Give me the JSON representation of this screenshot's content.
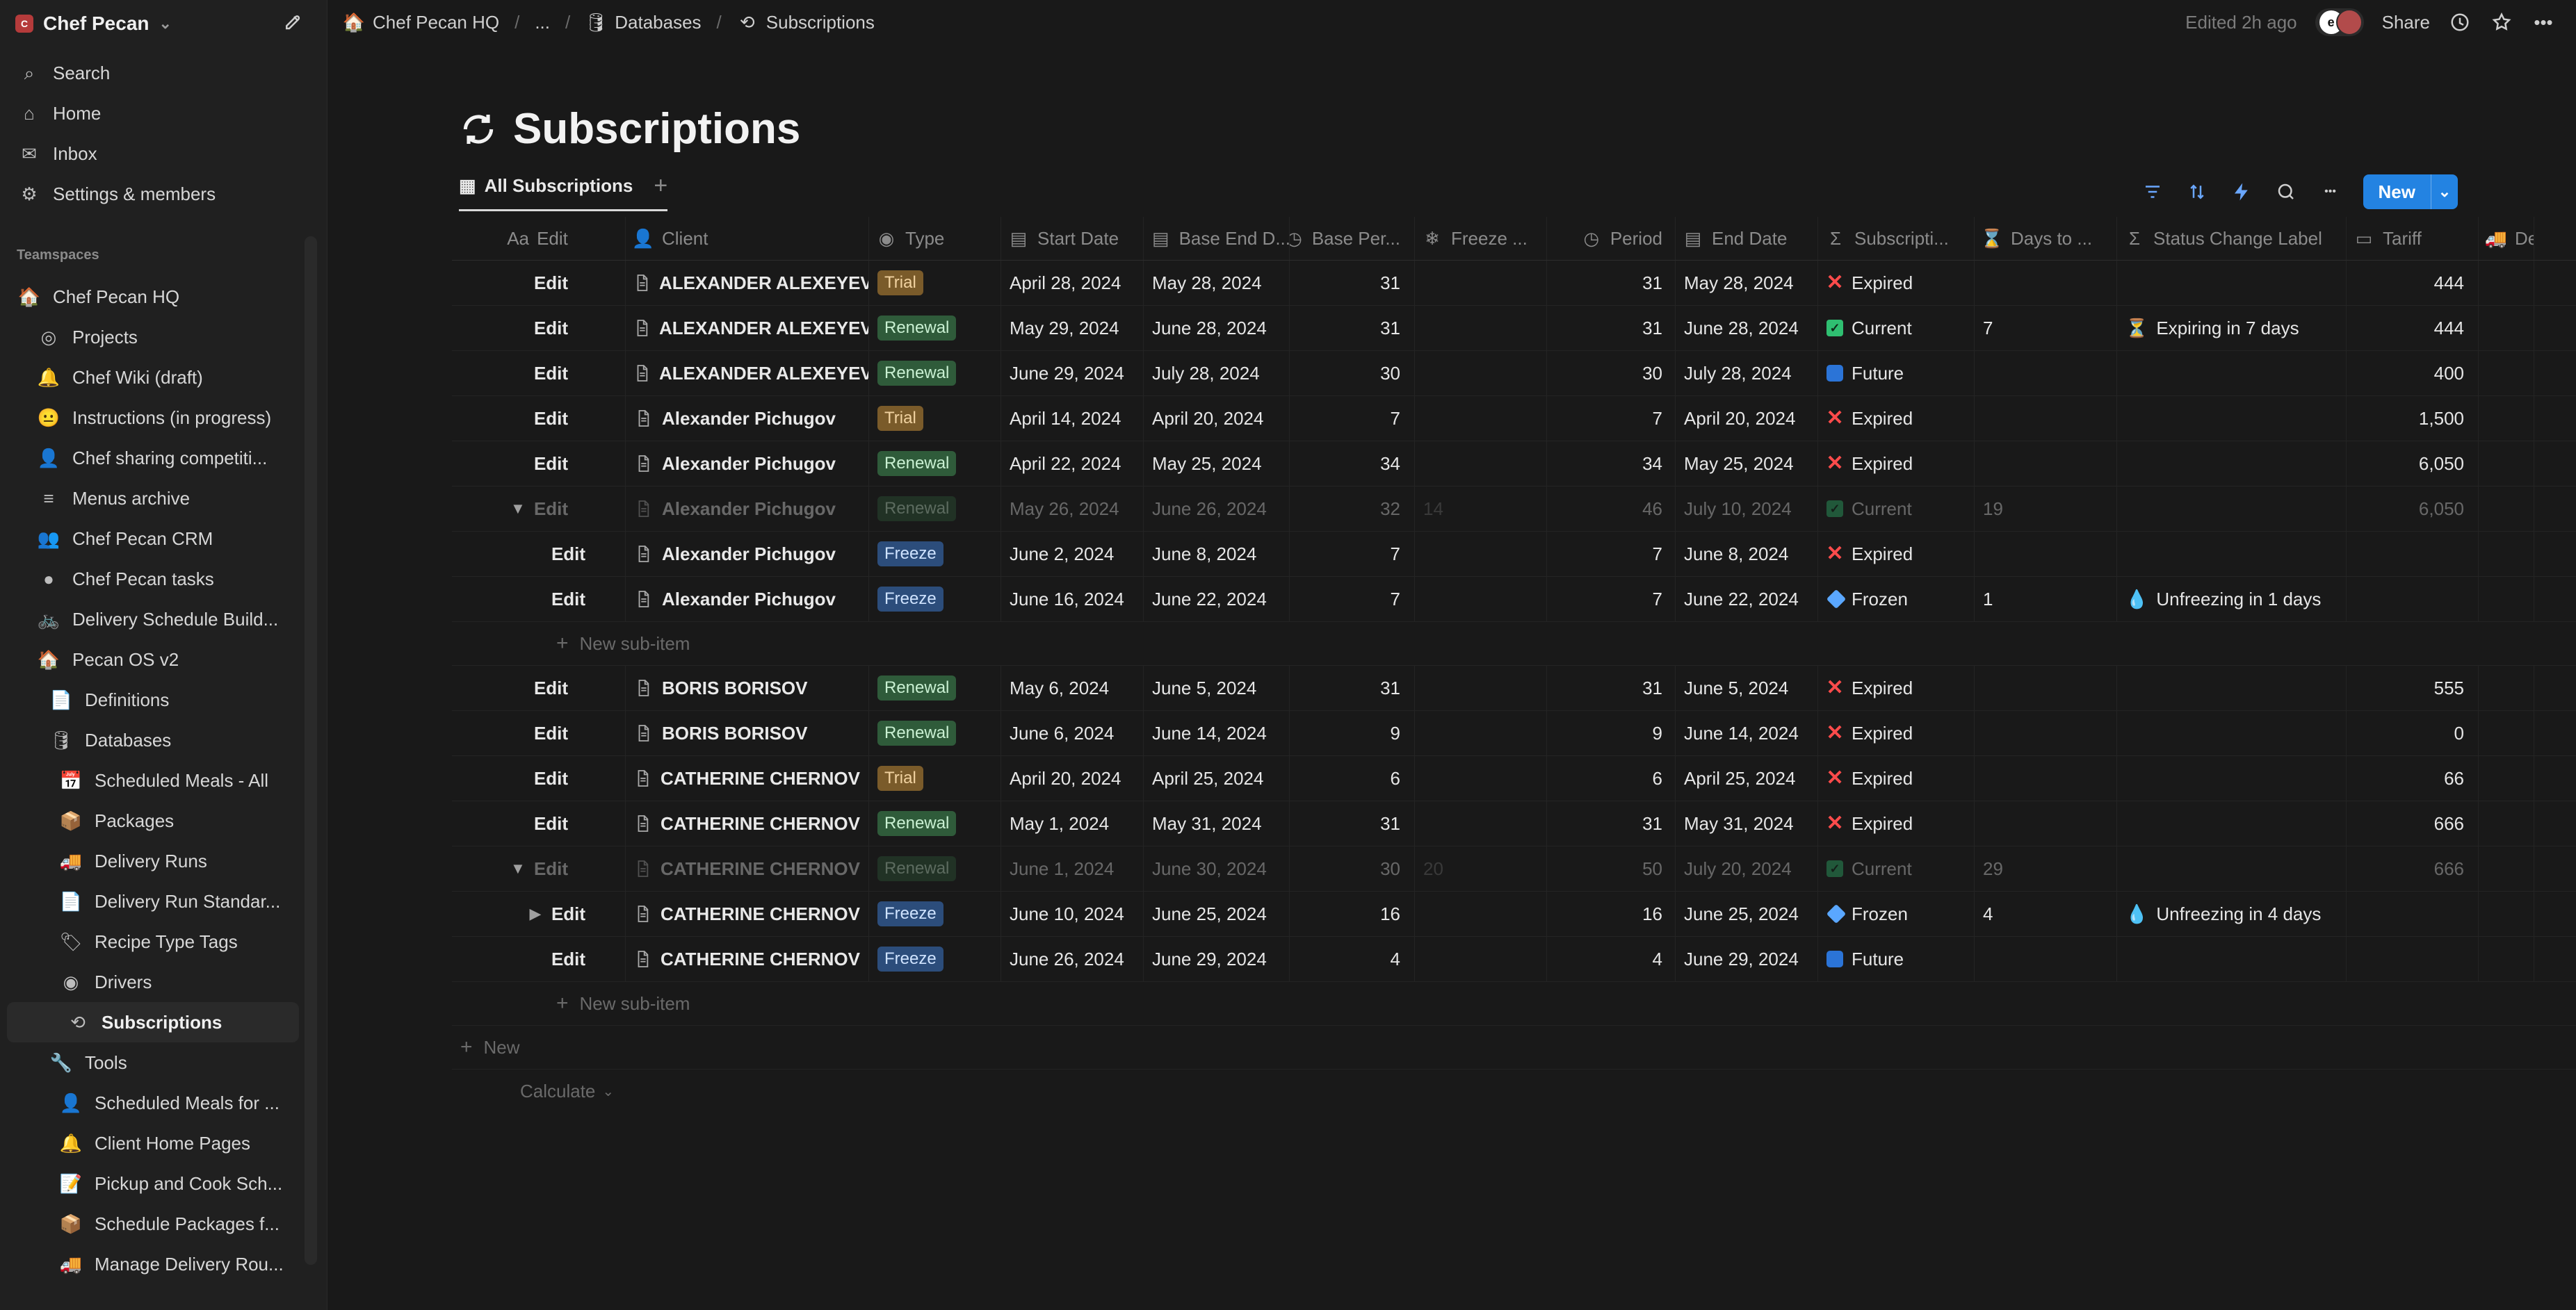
{
  "sidebar": {
    "workspace": {
      "name": "Chef Pecan",
      "avatar_letter": "C"
    },
    "nav": [
      {
        "name": "search",
        "label": "Search",
        "icon": "search-icon"
      },
      {
        "name": "home",
        "label": "Home",
        "icon": "home-icon"
      },
      {
        "name": "inbox",
        "label": "Inbox",
        "icon": "inbox-icon"
      },
      {
        "name": "settings",
        "label": "Settings & members",
        "icon": "gear-icon"
      }
    ],
    "section_label": "Teamspaces",
    "tree": [
      {
        "label": "Chef Pecan HQ",
        "icon": "house-icon",
        "level": 1
      },
      {
        "label": "Projects",
        "icon": "target-icon",
        "level": 2
      },
      {
        "label": "Chef Wiki (draft)",
        "icon": "bell-icon",
        "level": 2
      },
      {
        "label": "Instructions (in progress)",
        "icon": "face-icon",
        "level": 2
      },
      {
        "label": "Chef sharing competiti...",
        "icon": "person-icon",
        "level": 2
      },
      {
        "label": "Menus archive",
        "icon": "list-icon",
        "level": 2
      },
      {
        "label": "Chef Pecan CRM",
        "icon": "people-icon",
        "level": 2
      },
      {
        "label": "Chef Pecan tasks",
        "icon": "dot-icon",
        "level": 2
      },
      {
        "label": "Delivery Schedule Build...",
        "icon": "bike-icon",
        "level": 2
      },
      {
        "label": "Pecan OS v2",
        "icon": "house-icon",
        "level": 2
      },
      {
        "label": "Definitions",
        "icon": "doc-icon",
        "level": 3
      },
      {
        "label": "Databases",
        "icon": "database-icon",
        "level": 3
      },
      {
        "label": "Scheduled Meals - All",
        "icon": "calendar-icon",
        "level": 4
      },
      {
        "label": "Packages",
        "icon": "package-icon",
        "level": 4
      },
      {
        "label": "Delivery Runs",
        "icon": "truck-icon",
        "level": 4
      },
      {
        "label": "Delivery Run Standar...",
        "icon": "doc-icon",
        "level": 4
      },
      {
        "label": "Recipe Type Tags",
        "icon": "tag-icon",
        "level": 4
      },
      {
        "label": "Drivers",
        "icon": "circle-icon",
        "level": 4
      },
      {
        "label": "Subscriptions",
        "icon": "refresh-icon",
        "level": 4,
        "active": true
      },
      {
        "label": "Tools",
        "icon": "wrench-icon",
        "level": 3
      },
      {
        "label": "Scheduled Meals for ...",
        "icon": "person-icon",
        "level": 4
      },
      {
        "label": "Client Home Pages",
        "icon": "bell-icon",
        "level": 4
      },
      {
        "label": "Pickup and Cook Sch...",
        "icon": "note-icon",
        "level": 4
      },
      {
        "label": "Schedule Packages f...",
        "icon": "package-icon",
        "level": 4
      },
      {
        "label": "Manage Delivery Rou...",
        "icon": "truck-icon",
        "level": 4
      }
    ]
  },
  "topbar": {
    "breadcrumbs": [
      {
        "label": "Chef Pecan HQ",
        "icon": "house-icon"
      },
      {
        "label": "...",
        "icon": ""
      },
      {
        "label": "Databases",
        "icon": "database-icon"
      },
      {
        "label": "Subscriptions",
        "icon": "refresh-icon"
      }
    ],
    "edited": "Edited 2h ago",
    "share": "Share"
  },
  "page": {
    "title": "Subscriptions",
    "view_tab": "All Subscriptions",
    "new_label": "New"
  },
  "table": {
    "columns": [
      {
        "key": "edit",
        "label": "Edit",
        "icon": "aa-icon"
      },
      {
        "key": "client",
        "label": "Client",
        "icon": "person-icon"
      },
      {
        "key": "type",
        "label": "Type",
        "icon": "select-icon"
      },
      {
        "key": "start",
        "label": "Start Date",
        "icon": "calendar-icon"
      },
      {
        "key": "base_end",
        "label": "Base End D...",
        "icon": "calendar-icon"
      },
      {
        "key": "base_per",
        "label": "Base Per...",
        "icon": "clock-icon"
      },
      {
        "key": "freeze",
        "label": "Freeze ...",
        "icon": "snowflake-icon"
      },
      {
        "key": "period",
        "label": "Period",
        "icon": "clock-icon"
      },
      {
        "key": "end_date",
        "label": "End Date",
        "icon": "calendar-icon"
      },
      {
        "key": "subscription",
        "label": "Subscripti...",
        "icon": "sigma-icon"
      },
      {
        "key": "days_to",
        "label": "Days to ...",
        "icon": "hourglass-icon"
      },
      {
        "key": "status_change",
        "label": "Status Change Label",
        "icon": "sigma-icon"
      },
      {
        "key": "tariff",
        "label": "Tariff",
        "icon": "money-icon"
      },
      {
        "key": "delivery",
        "label": "Deliv",
        "icon": "truck-icon"
      }
    ],
    "rows": [
      {
        "edit": "Edit",
        "client": "ALEXANDER ALEXEYEV",
        "type": "Trial",
        "start": "April 28, 2024",
        "base_end": "May 28, 2024",
        "base_per": "31",
        "freeze": "",
        "period": "31",
        "end_date": "May 28, 2024",
        "subscription": "Expired",
        "days_to": "",
        "status_change": "",
        "tariff": "444",
        "dim": false,
        "indent": 0,
        "expander": ""
      },
      {
        "edit": "Edit",
        "client": "ALEXANDER ALEXEYEV",
        "type": "Renewal",
        "start": "May 29, 2024",
        "base_end": "June 28, 2024",
        "base_per": "31",
        "freeze": "",
        "period": "31",
        "end_date": "June 28, 2024",
        "subscription": "Current",
        "days_to": "7",
        "status_change": "Expiring in 7 days",
        "tariff": "444",
        "dim": false,
        "indent": 0,
        "expander": ""
      },
      {
        "edit": "Edit",
        "client": "ALEXANDER ALEXEYEV",
        "type": "Renewal",
        "start": "June 29, 2024",
        "base_end": "July 28, 2024",
        "base_per": "30",
        "freeze": "",
        "period": "30",
        "end_date": "July 28, 2024",
        "subscription": "Future",
        "days_to": "",
        "status_change": "",
        "tariff": "400",
        "dim": false,
        "indent": 0,
        "expander": ""
      },
      {
        "edit": "Edit",
        "client": "Alexander Pichugov",
        "type": "Trial",
        "start": "April 14, 2024",
        "base_end": "April 20, 2024",
        "base_per": "7",
        "freeze": "",
        "period": "7",
        "end_date": "April 20, 2024",
        "subscription": "Expired",
        "days_to": "",
        "status_change": "",
        "tariff": "1,500",
        "dim": false,
        "indent": 0,
        "expander": ""
      },
      {
        "edit": "Edit",
        "client": "Alexander Pichugov",
        "type": "Renewal",
        "start": "April 22, 2024",
        "base_end": "May 25, 2024",
        "base_per": "34",
        "freeze": "",
        "period": "34",
        "end_date": "May 25, 2024",
        "subscription": "Expired",
        "days_to": "",
        "status_change": "",
        "tariff": "6,050",
        "dim": false,
        "indent": 0,
        "expander": ""
      },
      {
        "edit": "Edit",
        "client": "Alexander Pichugov",
        "type": "Renewal",
        "start": "May 26, 2024",
        "base_end": "June 26, 2024",
        "base_per": "32",
        "freeze": "14",
        "period": "46",
        "end_date": "July 10, 2024",
        "subscription": "Current",
        "days_to": "19",
        "status_change": "",
        "tariff": "6,050",
        "dim": true,
        "indent": 0,
        "expander": "▼"
      },
      {
        "edit": "Edit",
        "client": "Alexander Pichugov",
        "type": "Freeze",
        "start": "June 2, 2024",
        "base_end": "June 8, 2024",
        "base_per": "7",
        "freeze": "",
        "period": "7",
        "end_date": "June 8, 2024",
        "subscription": "Expired",
        "days_to": "",
        "status_change": "",
        "tariff": "",
        "dim": false,
        "indent": 1,
        "expander": ""
      },
      {
        "edit": "Edit",
        "client": "Alexander Pichugov",
        "type": "Freeze",
        "start": "June 16, 2024",
        "base_end": "June 22, 2024",
        "base_per": "7",
        "freeze": "",
        "period": "7",
        "end_date": "June 22, 2024",
        "subscription": "Frozen",
        "days_to": "1",
        "status_change": "Unfreezing in 1 days",
        "tariff": "",
        "dim": false,
        "indent": 1,
        "expander": ""
      },
      {
        "type_row": "newsub",
        "label": "New sub-item"
      },
      {
        "edit": "Edit",
        "client": "BORIS BORISOV",
        "type": "Renewal",
        "start": "May 6, 2024",
        "base_end": "June 5, 2024",
        "base_per": "31",
        "freeze": "",
        "period": "31",
        "end_date": "June 5, 2024",
        "subscription": "Expired",
        "days_to": "",
        "status_change": "",
        "tariff": "555",
        "dim": false,
        "indent": 0,
        "expander": ""
      },
      {
        "edit": "Edit",
        "client": "BORIS BORISOV",
        "type": "Renewal",
        "start": "June 6, 2024",
        "base_end": "June 14, 2024",
        "base_per": "9",
        "freeze": "",
        "period": "9",
        "end_date": "June 14, 2024",
        "subscription": "Expired",
        "days_to": "",
        "status_change": "",
        "tariff": "0",
        "dim": false,
        "indent": 0,
        "expander": ""
      },
      {
        "edit": "Edit",
        "client": "CATHERINE CHERNOV",
        "type": "Trial",
        "start": "April 20, 2024",
        "base_end": "April 25, 2024",
        "base_per": "6",
        "freeze": "",
        "period": "6",
        "end_date": "April 25, 2024",
        "subscription": "Expired",
        "days_to": "",
        "status_change": "",
        "tariff": "66",
        "dim": false,
        "indent": 0,
        "expander": ""
      },
      {
        "edit": "Edit",
        "client": "CATHERINE CHERNOV",
        "type": "Renewal",
        "start": "May 1, 2024",
        "base_end": "May 31, 2024",
        "base_per": "31",
        "freeze": "",
        "period": "31",
        "end_date": "May 31, 2024",
        "subscription": "Expired",
        "days_to": "",
        "status_change": "",
        "tariff": "666",
        "dim": false,
        "indent": 0,
        "expander": ""
      },
      {
        "edit": "Edit",
        "client": "CATHERINE CHERNOV",
        "type": "Renewal",
        "start": "June 1, 2024",
        "base_end": "June 30, 2024",
        "base_per": "30",
        "freeze": "20",
        "period": "50",
        "end_date": "July 20, 2024",
        "subscription": "Current",
        "days_to": "29",
        "status_change": "",
        "tariff": "666",
        "dim": true,
        "indent": 0,
        "expander": "▼"
      },
      {
        "edit": "Edit",
        "client": "CATHERINE CHERNOV",
        "type": "Freeze",
        "start": "June 10, 2024",
        "base_end": "June 25, 2024",
        "base_per": "16",
        "freeze": "",
        "period": "16",
        "end_date": "June 25, 2024",
        "subscription": "Frozen",
        "days_to": "4",
        "status_change": "Unfreezing in 4 days",
        "tariff": "",
        "dim": false,
        "indent": 1,
        "expander": "▶"
      },
      {
        "edit": "Edit",
        "client": "CATHERINE CHERNOV",
        "type": "Freeze",
        "start": "June 26, 2024",
        "base_end": "June 29, 2024",
        "base_per": "4",
        "freeze": "",
        "period": "4",
        "end_date": "June 29, 2024",
        "subscription": "Future",
        "days_to": "",
        "status_change": "",
        "tariff": "",
        "dim": false,
        "indent": 1,
        "expander": ""
      },
      {
        "type_row": "newsub",
        "label": "New sub-item"
      }
    ],
    "footer_new": "New",
    "calculate": "Calculate"
  }
}
